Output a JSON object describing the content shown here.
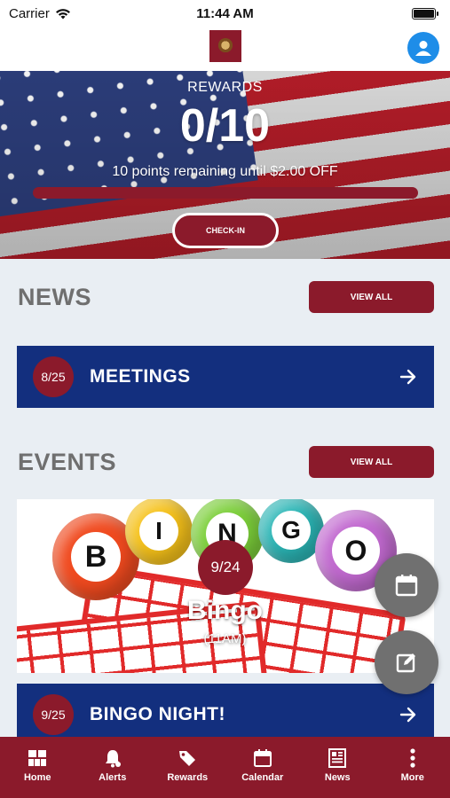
{
  "status_bar": {
    "carrier": "Carrier",
    "time": "11:44 AM"
  },
  "rewards": {
    "label": "REWARDS",
    "count": "0/10",
    "remaining_text": "10 points remaining until $2.00 OFF",
    "progress_fraction": 0,
    "checkin_label": "CHECK-IN"
  },
  "news": {
    "title": "NEWS",
    "view_all_label": "VIEW ALL",
    "items": [
      {
        "date": "8/25",
        "title": "MEETINGS"
      }
    ]
  },
  "events": {
    "title": "EVENTS",
    "view_all_label": "VIEW ALL",
    "featured": {
      "date": "9/24",
      "name": "Bingo",
      "time": "(11AM)",
      "image_letters": [
        "B",
        "I",
        "N",
        "G",
        "O"
      ]
    },
    "items": [
      {
        "date": "9/25",
        "title": "BINGO NIGHT!"
      }
    ]
  },
  "fabs": [
    {
      "icon": "calendar-icon"
    },
    {
      "icon": "edit-icon"
    }
  ],
  "tabbar": {
    "tabs": [
      {
        "label": "Home",
        "icon": "home-icon"
      },
      {
        "label": "Alerts",
        "icon": "bell-icon"
      },
      {
        "label": "Rewards",
        "icon": "tag-icon"
      },
      {
        "label": "Calendar",
        "icon": "calendar-icon"
      },
      {
        "label": "News",
        "icon": "newspaper-icon"
      },
      {
        "label": "More",
        "icon": "more-icon"
      }
    ]
  },
  "colors": {
    "brand": "#8b1a2b",
    "navy": "#132f7e",
    "accent_blue": "#1e8de8",
    "fab_gray": "#707070"
  }
}
